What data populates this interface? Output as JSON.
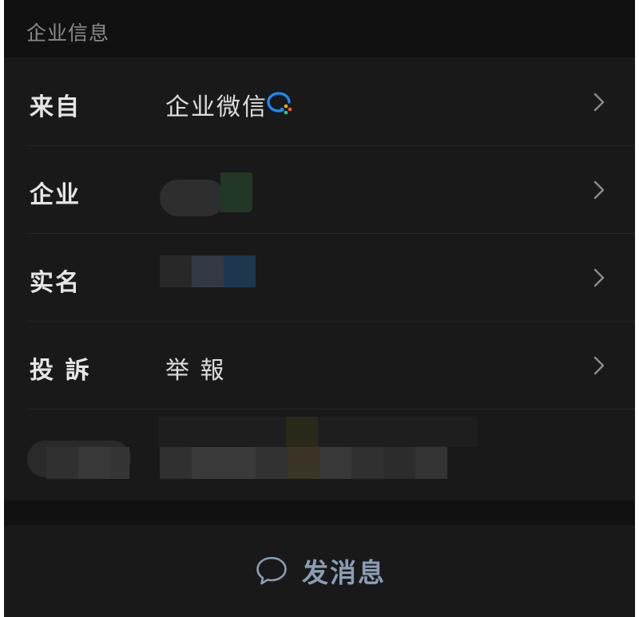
{
  "section": {
    "title": "企业信息"
  },
  "rows": [
    {
      "label": "来自",
      "value": "企业微信"
    },
    {
      "label": "企业",
      "value": ""
    },
    {
      "label": "实名",
      "value": ""
    },
    {
      "label": "投 訴",
      "value": "举 報"
    }
  ],
  "footer": {
    "send_label": "发消息"
  },
  "colors": {
    "background": "#111111",
    "row_background": "#191919",
    "text": "#e6e6e6",
    "accent": "#8a9db5",
    "brand_blue": "#1a8cff"
  },
  "icons": [
    "wecom-logo-icon",
    "chevron-right-icon",
    "chat-bubble-icon"
  ]
}
